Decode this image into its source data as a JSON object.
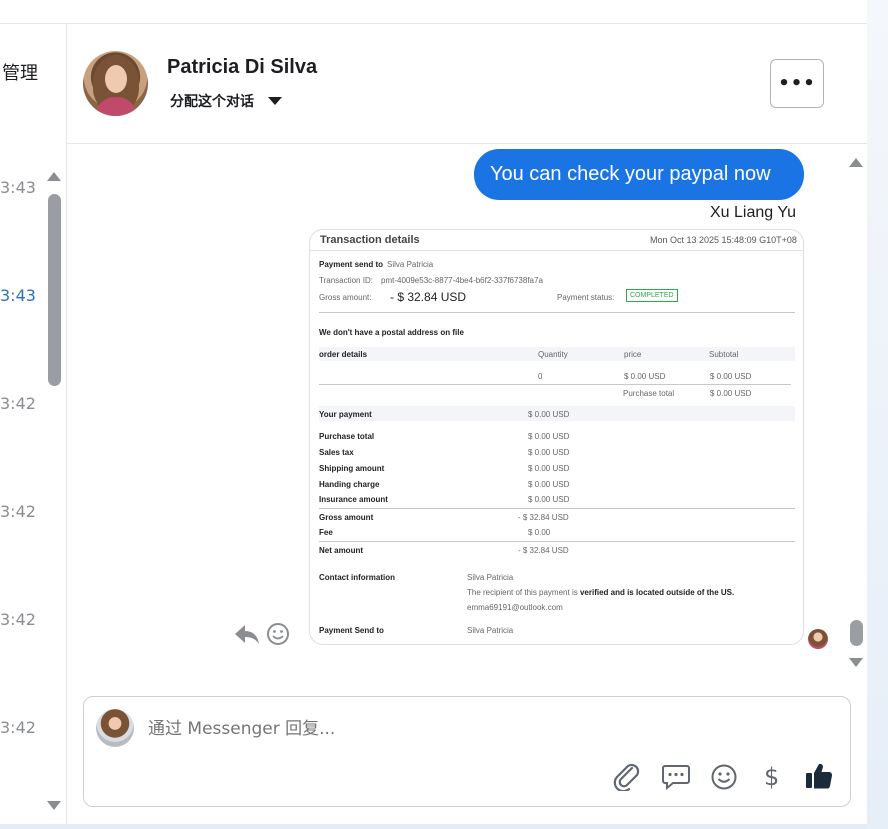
{
  "left_list": {
    "manage_label": "管理",
    "times": [
      {
        "text": "3:43",
        "active": false
      },
      {
        "text": "3:43",
        "active": true
      },
      {
        "text": "3:42",
        "active": false
      },
      {
        "text": "3:42",
        "active": false
      },
      {
        "text": "3:42",
        "active": false
      },
      {
        "text": "3:42",
        "active": false
      }
    ]
  },
  "header": {
    "contact_name": "Patricia Di Silva",
    "assign_label": "分配这个对话",
    "more_label": "•••"
  },
  "conversation": {
    "message_text": "You can check your paypal now",
    "sender_name": "Xu Liang Yu",
    "accent_color": "#1b74e4"
  },
  "receipt": {
    "title": "Transaction details",
    "date": "Mon Oct 13 2025 15:48:09 G10T+08",
    "payment_send_to_label": "Payment send to",
    "payment_send_to_value": "Silva Patricia",
    "transaction_id_label": "Transaction ID:",
    "transaction_id_value": "pmt-4009e53c-8877-4be4-b6f2-337f6738fa7a",
    "gross_amount_label": "Gross amount:",
    "gross_amount_value": "- $  32.84 USD",
    "payment_status_label": "Payment status:",
    "payment_status_value": "COMPLETED",
    "postal_note": "We don't have a postal address on file",
    "order_headers": [
      "order details",
      "Quantity",
      "price",
      "Subtotal"
    ],
    "order_row": {
      "quantity": "0",
      "price": "$  0.00 USD",
      "subtotal": "$  0.00 USD"
    },
    "purchase_total_label": "Purchase total",
    "purchase_total_value": "$  0.00 USD",
    "your_payment_label": "Your payment",
    "your_payment_value": "$  0.00 USD",
    "breakdown": [
      {
        "label": "Purchase total",
        "value": "$  0.00 USD"
      },
      {
        "label": "Sales tax",
        "value": "$  0.00 USD"
      },
      {
        "label": "Shipping amount",
        "value": "$  0.00 USD"
      },
      {
        "label": "Handing charge",
        "value": "$  0.00 USD"
      },
      {
        "label": "Insurance amount",
        "value": "$  0.00 USD"
      }
    ],
    "gross_label": "Gross amount",
    "gross_value": "- $  32.84 USD",
    "fee_label": "Fee",
    "fee_value": "$  0.00",
    "net_label": "Net amount",
    "net_value": "- $  32.84 USD",
    "contact_label": "Contact information",
    "contact_name": "Silva Patricia",
    "contact_note_prefix": "The recipient of this payment is ",
    "contact_note_bold": "verified and is located outside of the US.",
    "contact_email": "emma69191@outlook.com",
    "payment_send_to2_label": "Payment Send to",
    "payment_send_to2_value": "Silva Patricia"
  },
  "composer": {
    "placeholder": "通过 Messenger 回复..."
  }
}
